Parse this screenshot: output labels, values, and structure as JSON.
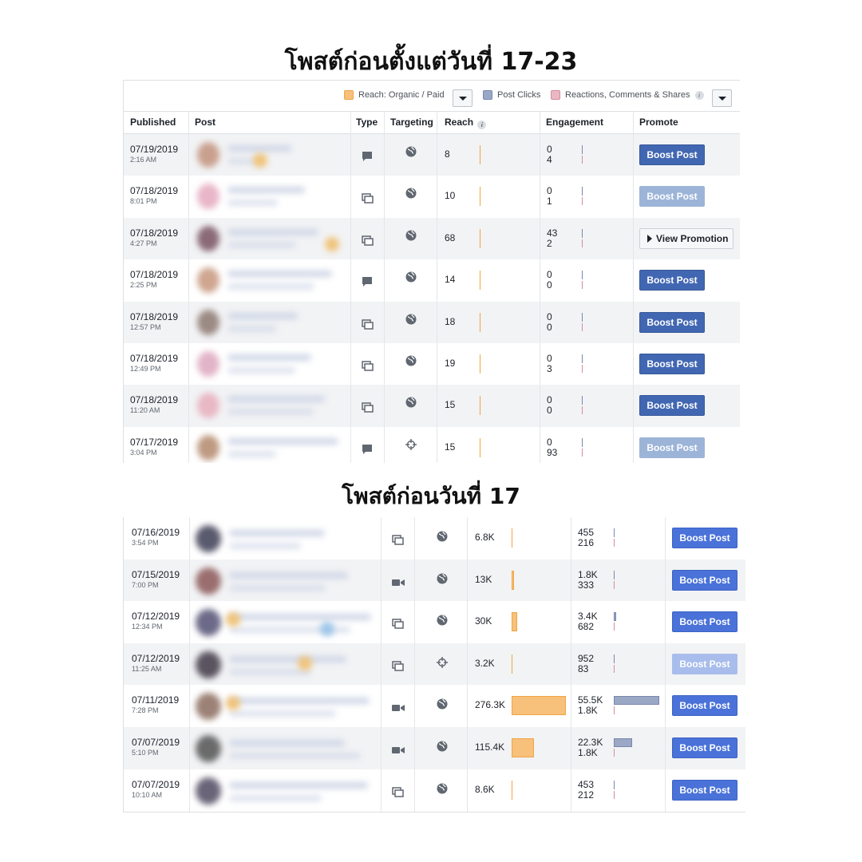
{
  "headings": {
    "first": "โพสต์ก่อนตั้งแต่วันที่ 17-23",
    "second": "โพสต์ก่อนวันที่ 17"
  },
  "colors": {
    "accent_blue": "#4267b2",
    "boost_disabled": "#9cb4d8",
    "organic": "#f7c07b",
    "post_clicks": "#9aa8c6",
    "reactions": "#d88a9c"
  },
  "legend": {
    "reach": "Reach: Organic / Paid",
    "clicks": "Post Clicks",
    "reactions": "Reactions, Comments & Shares"
  },
  "columns": {
    "published": "Published",
    "post": "Post",
    "type": "Type",
    "targeting": "Targeting",
    "reach": "Reach",
    "engagement": "Engagement",
    "promote": "Promote"
  },
  "recent_posts": [
    {
      "date": "07/19/2019",
      "time": "2:16 AM",
      "type": "status-icon",
      "targeting": "globe-icon",
      "reach": "8",
      "clicks": "0",
      "reactions": "4",
      "action": "Boost Post",
      "action_state": "enabled",
      "reach_level": 0.02
    },
    {
      "date": "07/18/2019",
      "time": "8:01 PM",
      "type": "multi-photo-icon",
      "targeting": "globe-icon",
      "reach": "10",
      "clicks": "0",
      "reactions": "1",
      "action": "Boost Post",
      "action_state": "disabled",
      "reach_level": 0.02
    },
    {
      "date": "07/18/2019",
      "time": "4:27 PM",
      "type": "multi-photo-icon",
      "targeting": "globe-icon",
      "reach": "68",
      "clicks": "43",
      "reactions": "2",
      "action": "View Promotion",
      "action_state": "promotion",
      "reach_level": 0.02
    },
    {
      "date": "07/18/2019",
      "time": "2:25 PM",
      "type": "status-icon",
      "targeting": "globe-icon",
      "reach": "14",
      "clicks": "0",
      "reactions": "0",
      "action": "Boost Post",
      "action_state": "enabled",
      "reach_level": 0.02
    },
    {
      "date": "07/18/2019",
      "time": "12:57 PM",
      "type": "multi-photo-icon",
      "targeting": "globe-icon",
      "reach": "18",
      "clicks": "0",
      "reactions": "0",
      "action": "Boost Post",
      "action_state": "enabled",
      "reach_level": 0.02
    },
    {
      "date": "07/18/2019",
      "time": "12:49 PM",
      "type": "multi-photo-icon",
      "targeting": "globe-icon",
      "reach": "19",
      "clicks": "0",
      "reactions": "3",
      "action": "Boost Post",
      "action_state": "enabled",
      "reach_level": 0.02
    },
    {
      "date": "07/18/2019",
      "time": "11:20 AM",
      "type": "multi-photo-icon",
      "targeting": "globe-icon",
      "reach": "15",
      "clicks": "0",
      "reactions": "0",
      "action": "Boost Post",
      "action_state": "enabled",
      "reach_level": 0.02
    },
    {
      "date": "07/17/2019",
      "time": "3:04 PM",
      "type": "status-icon",
      "targeting": "crosshair-icon",
      "reach": "15",
      "clicks": "0",
      "reactions": "93",
      "action": "Boost Post",
      "action_state": "disabled",
      "reach_level": 0.02
    }
  ],
  "older_posts": [
    {
      "date": "07/16/2019",
      "time": "3:54 PM",
      "type": "multi-photo-icon",
      "targeting": "globe-icon",
      "reach": "6.8K",
      "clicks": "455",
      "reactions": "216",
      "action": "Boost Post",
      "action_state": "enabled",
      "reach_level": 0.025,
      "clicks_level": 0.0
    },
    {
      "date": "07/15/2019",
      "time": "7:00 PM",
      "type": "video-icon",
      "targeting": "globe-icon",
      "reach": "13K",
      "clicks": "1.8K",
      "reactions": "333",
      "action": "Boost Post",
      "action_state": "enabled",
      "reach_level": 0.047,
      "clicks_level": 0.03
    },
    {
      "date": "07/12/2019",
      "time": "12:34 PM",
      "type": "multi-photo-icon",
      "targeting": "globe-icon",
      "reach": "30K",
      "clicks": "3.4K",
      "reactions": "682",
      "action": "Boost Post",
      "action_state": "enabled",
      "reach_level": 0.109,
      "clicks_level": 0.061
    },
    {
      "date": "07/12/2019",
      "time": "11:25 AM",
      "type": "multi-photo-icon",
      "targeting": "crosshair-icon",
      "reach": "3.2K",
      "clicks": "952",
      "reactions": "83",
      "action": "Boost Post",
      "action_state": "disabled",
      "reach_level": 0.012,
      "clicks_level": 0.0
    },
    {
      "date": "07/11/2019",
      "time": "7:28 PM",
      "type": "video-icon",
      "targeting": "globe-icon",
      "reach": "276.3K",
      "clicks": "55.5K",
      "reactions": "1.8K",
      "action": "Boost Post",
      "action_state": "enabled",
      "reach_level": 1.0,
      "clicks_level": 1.0
    },
    {
      "date": "07/07/2019",
      "time": "5:10 PM",
      "type": "video-icon",
      "targeting": "globe-icon",
      "reach": "115.4K",
      "clicks": "22.3K",
      "reactions": "1.8K",
      "action": "Boost Post",
      "action_state": "enabled",
      "reach_level": 0.418,
      "clicks_level": 0.402
    },
    {
      "date": "07/07/2019",
      "time": "10:10 AM",
      "type": "multi-photo-icon",
      "targeting": "globe-icon",
      "reach": "8.6K",
      "clicks": "453",
      "reactions": "212",
      "action": "Boost Post",
      "action_state": "enabled",
      "reach_level": 0.031,
      "clicks_level": 0.0
    }
  ]
}
